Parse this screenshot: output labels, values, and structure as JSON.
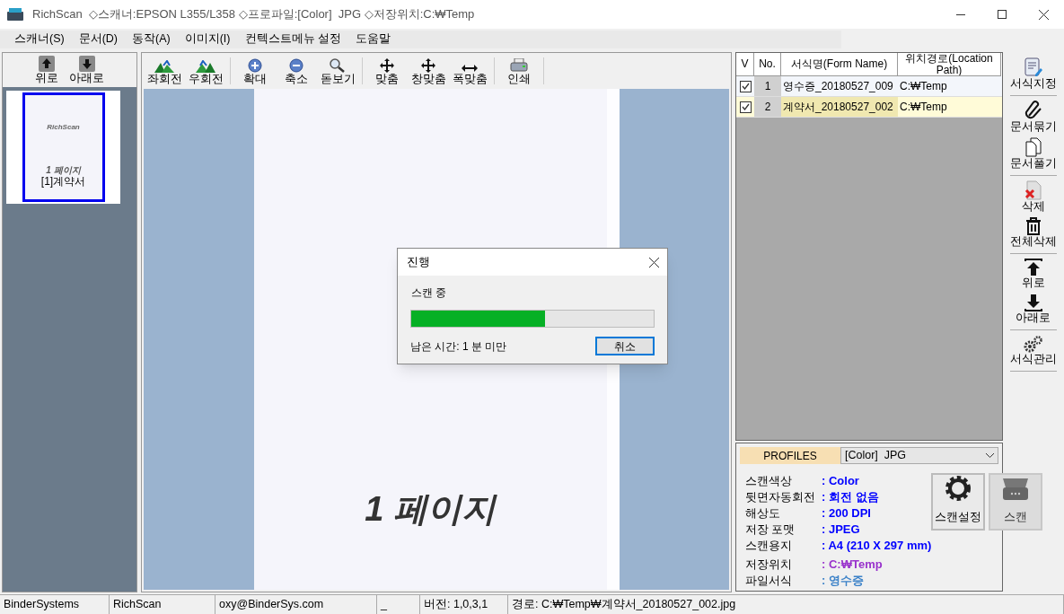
{
  "window": {
    "title": "RichScan  ◇스캐너:EPSON L355/L358 ◇프로파일:[Color]  JPG ◇저장위치:C:₩Temp"
  },
  "menu": [
    "스캐너(S)",
    "문서(D)",
    "동작(A)",
    "이미지(I)",
    "컨텍스트메뉴 설정",
    "도움말"
  ],
  "thumb_toolbar": [
    {
      "label": "위로",
      "kind": "up"
    },
    {
      "label": "아래로",
      "kind": "down"
    }
  ],
  "thumbnails": [
    {
      "logo": "RichScan",
      "page": "1 페이지",
      "caption": "[1]계약서",
      "selected": true
    }
  ],
  "viewer_toolbar": [
    {
      "label": "좌회전",
      "kind": "rotl"
    },
    {
      "label": "우회전",
      "kind": "rotr"
    },
    {
      "kind": "sep"
    },
    {
      "label": "확대",
      "kind": "zoomin"
    },
    {
      "label": "축소",
      "kind": "zoomout"
    },
    {
      "label": "돋보기",
      "kind": "magnifier"
    },
    {
      "kind": "sep"
    },
    {
      "label": "맞춤",
      "kind": "move"
    },
    {
      "label": "창맞춤",
      "kind": "move"
    },
    {
      "label": "폭맞춤",
      "kind": "width"
    },
    {
      "kind": "sep"
    },
    {
      "label": "인쇄",
      "kind": "print"
    }
  ],
  "document": {
    "page": "1 페이지"
  },
  "dialog": {
    "title": "진행",
    "message": "스캔 중",
    "level": 0.55,
    "remaining": "남은 시간: 1 분 미만",
    "button": "취소"
  },
  "table": {
    "columns": [
      "V",
      "No.",
      "서식명(Form Name)",
      "위치경로(Location Path)"
    ],
    "rows": [
      {
        "checked": true,
        "no": "1",
        "name": "영수증_20180527_009",
        "path": "C:₩Temp",
        "selected": false
      },
      {
        "checked": true,
        "no": "2",
        "name": "계약서_20180527_002",
        "path": "C:₩Temp",
        "selected": true
      }
    ]
  },
  "profiles": {
    "label": "PROFILES",
    "value": "[Color]  JPG",
    "settings": [
      {
        "label": "스캔색상",
        "value": ": Color",
        "color": "#0000ff"
      },
      {
        "label": "뒷면자동회전",
        "value": ": 회전 없음",
        "color": "#0000ff"
      },
      {
        "label": "해상도",
        "value": ": 200 DPI",
        "color": "#0000ff"
      },
      {
        "label": "저장 포맷",
        "value": ": JPEG",
        "color": "#0000ff"
      },
      {
        "label": "스캔용지",
        "value": ": A4 (210 X 297 mm)",
        "color": "#0000ff"
      },
      {
        "label": "저장위치",
        "value": ": C:₩Temp",
        "color": "#9933cc"
      },
      {
        "label": "파일서식",
        "value": ": 영수증",
        "color": "#3c82c8"
      }
    ],
    "buttons": [
      {
        "label": "스캔설정",
        "kind": "gear"
      },
      {
        "label": "스캔",
        "kind": "scanner"
      }
    ]
  },
  "side_toolbar": [
    {
      "label": "서식지정",
      "kind": "form"
    },
    {
      "kind": "sep"
    },
    {
      "label": "문서묶기",
      "kind": "clip"
    },
    {
      "label": "문서풀기",
      "kind": "pages"
    },
    {
      "kind": "sep"
    },
    {
      "label": "삭제",
      "kind": "delete"
    },
    {
      "label": "전체삭제",
      "kind": "trash"
    },
    {
      "kind": "sep"
    },
    {
      "label": "위로",
      "kind": "up"
    },
    {
      "label": "아래로",
      "kind": "down"
    },
    {
      "kind": "sep"
    },
    {
      "label": "서식관리",
      "kind": "gears"
    }
  ],
  "status_bar": [
    "BinderSystems",
    "RichScan",
    "oxy@BinderSys.com",
    "_",
    "버전: 1,0,3,1",
    "경로: C:₩Temp₩계약서_20180527_002.jpg"
  ]
}
